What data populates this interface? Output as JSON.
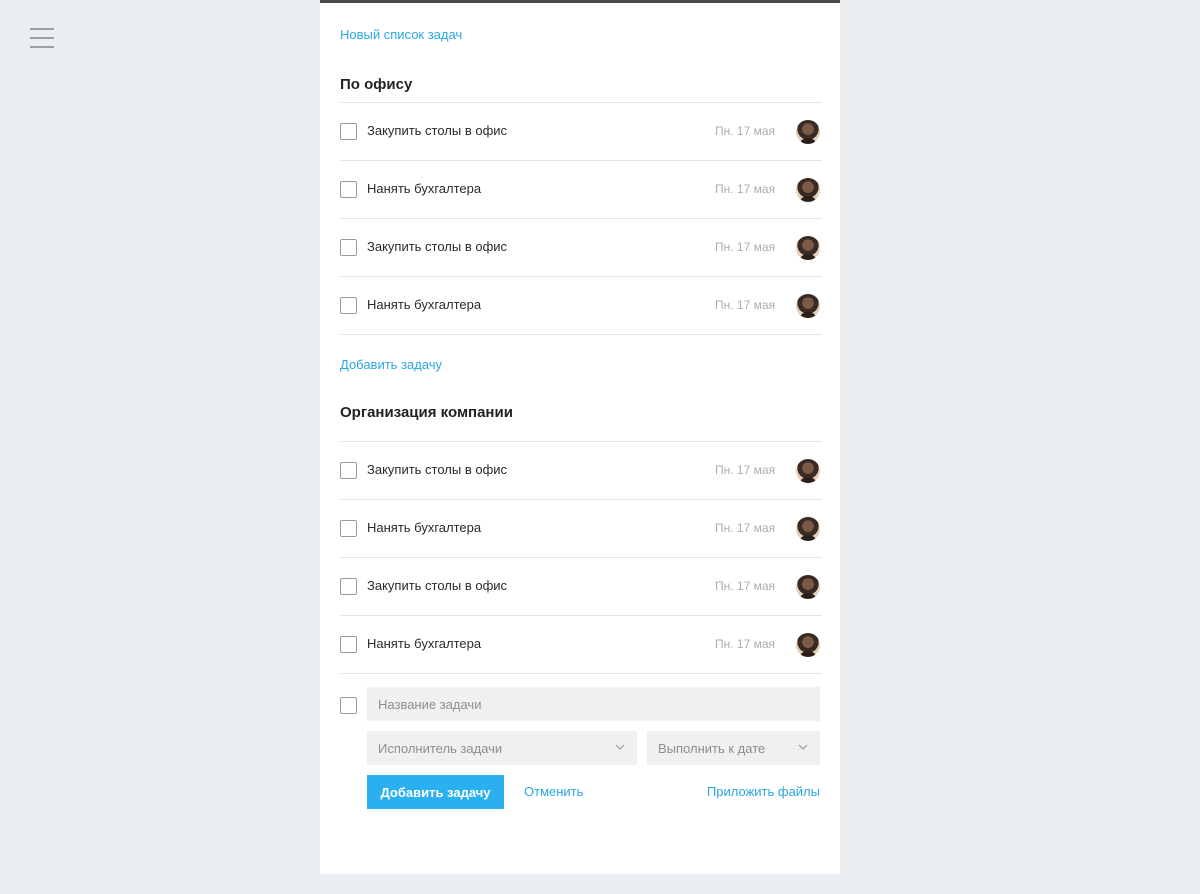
{
  "header": {
    "new_list_link": "Новый список задач"
  },
  "groups": [
    {
      "title": "По офису",
      "tasks": [
        {
          "name": "Закупить столы в офис",
          "date": "Пн. 17 мая"
        },
        {
          "name": "Нанять бухгалтера",
          "date": "Пн. 17 мая"
        },
        {
          "name": "Закупить столы в офис",
          "date": "Пн. 17 мая"
        },
        {
          "name": "Нанять бухгалтера",
          "date": "Пн. 17 мая"
        }
      ],
      "add_task_link": "Добавить задачу"
    },
    {
      "title": "Организация компании",
      "tasks": [
        {
          "name": "Закупить столы в офис",
          "date": "Пн. 17 мая"
        },
        {
          "name": "Нанять бухгалтера",
          "date": "Пн. 17 мая"
        },
        {
          "name": "Закупить столы в офис",
          "date": "Пн. 17 мая"
        },
        {
          "name": "Нанять бухгалтера",
          "date": "Пн. 17 мая"
        }
      ]
    }
  ],
  "form": {
    "title_placeholder": "Название задачи",
    "assignee_placeholder": "Исполнитель задачи",
    "due_placeholder": "Выполнить к дате",
    "submit_label": "Добавить задачу",
    "cancel_label": "Отменить",
    "attach_label": "Приложить файлы"
  },
  "icons": {
    "menu": "hamburger-menu-icon",
    "chevron": "chevron-down-icon",
    "avatar": "user-avatar"
  },
  "colors": {
    "accent": "#29a8e0",
    "button": "#2bb0ef",
    "background": "#ebeff2",
    "panel": "#ffffff"
  }
}
